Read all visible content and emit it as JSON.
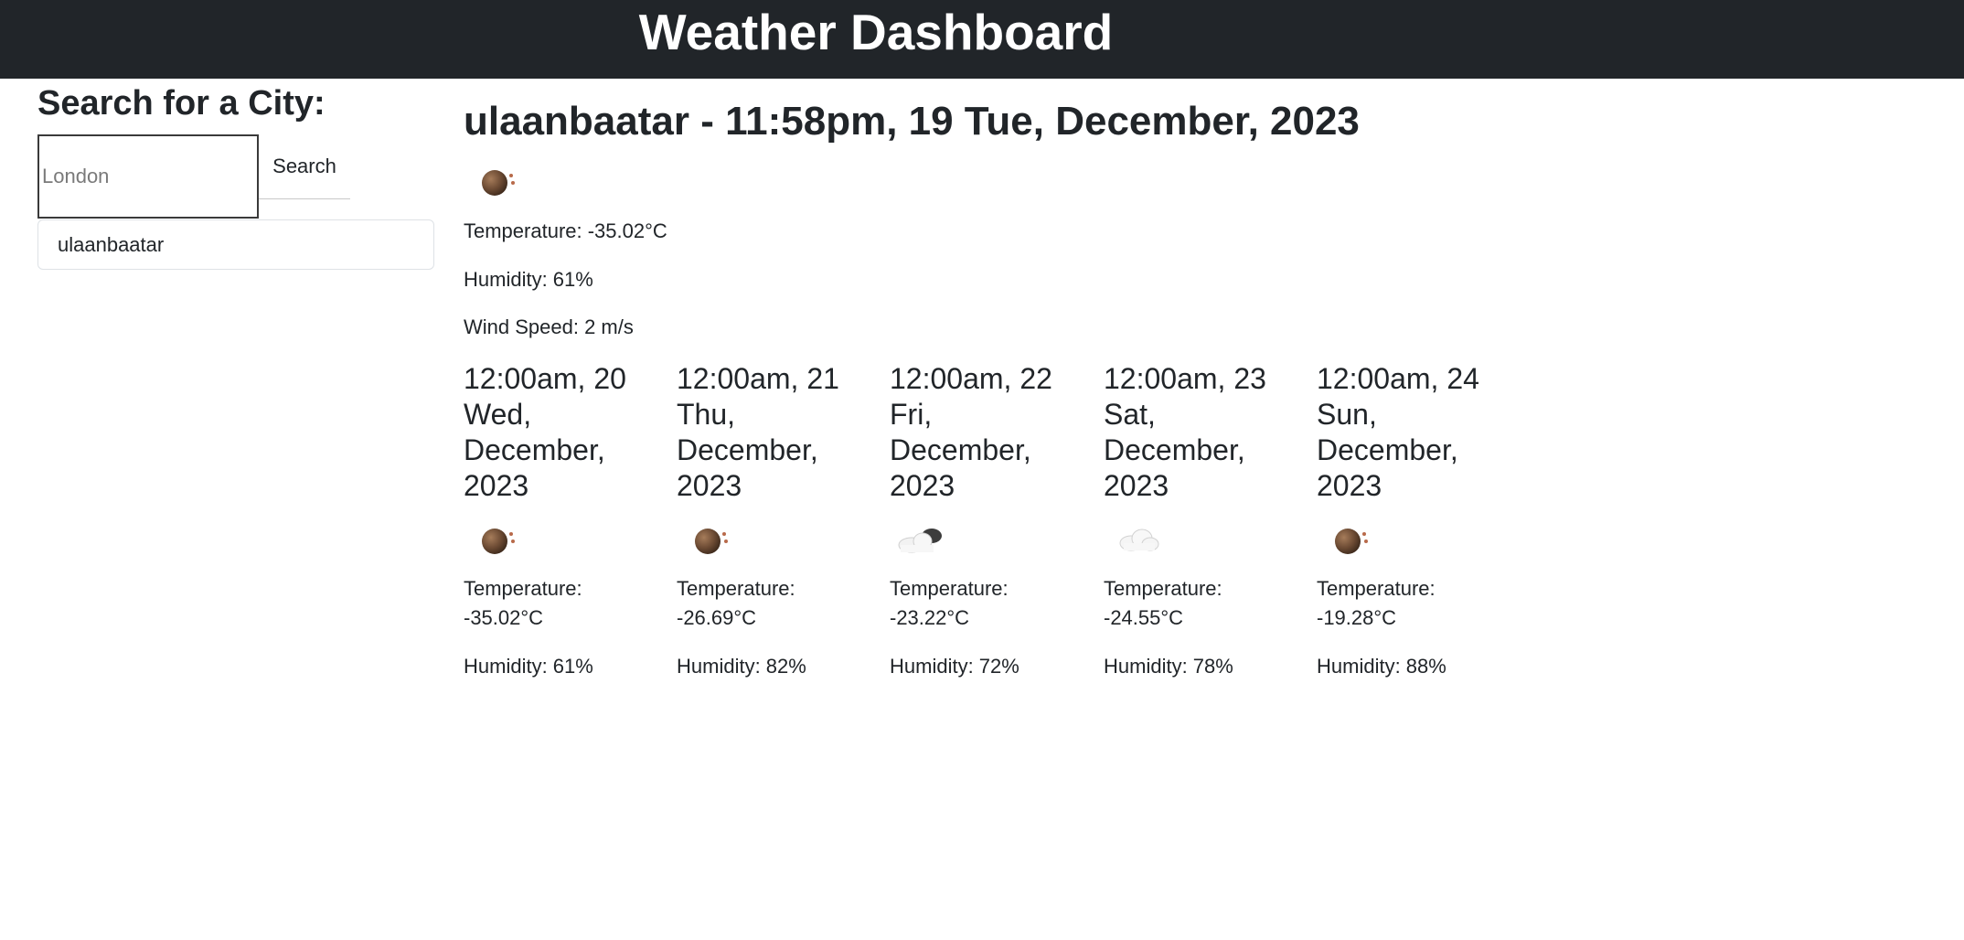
{
  "header": {
    "title": "Weather Dashboard"
  },
  "search": {
    "heading": "Search for a City:",
    "placeholder": "London",
    "value": "",
    "button_label": "Search",
    "history": [
      "ulaanbaatar"
    ]
  },
  "current": {
    "title": "ulaanbaatar - 11:58pm, 19 Tue, December, 2023",
    "icon": "haze-icon",
    "temperature": "Temperature: -35.02°C",
    "humidity": "Humidity: 61%",
    "wind": "Wind Speed: 2 m/s"
  },
  "forecast": [
    {
      "date_line1": "12:00am, 20",
      "date_line2": "Wed,",
      "date_line3": "December,",
      "date_line4": "2023",
      "icon": "haze-icon",
      "temp_label": "Temperature:",
      "temp_value": "-35.02°C",
      "humidity": "Humidity: 61%"
    },
    {
      "date_line1": "12:00am, 21",
      "date_line2": "Thu,",
      "date_line3": "December,",
      "date_line4": "2023",
      "icon": "haze-icon",
      "temp_label": "Temperature:",
      "temp_value": "-26.69°C",
      "humidity": "Humidity: 82%"
    },
    {
      "date_line1": "12:00am, 22",
      "date_line2": "Fri,",
      "date_line3": "December,",
      "date_line4": "2023",
      "icon": "broken-clouds-icon",
      "temp_label": "Temperature:",
      "temp_value": "-23.22°C",
      "humidity": "Humidity: 72%"
    },
    {
      "date_line1": "12:00am, 23",
      "date_line2": "Sat,",
      "date_line3": "December,",
      "date_line4": "2023",
      "icon": "cloud-icon",
      "temp_label": "Temperature:",
      "temp_value": "-24.55°C",
      "humidity": "Humidity: 78%"
    },
    {
      "date_line1": "12:00am, 24",
      "date_line2": "Sun,",
      "date_line3": "December,",
      "date_line4": "2023",
      "icon": "haze-icon",
      "temp_label": "Temperature:",
      "temp_value": "-19.28°C",
      "humidity": "Humidity: 88%"
    }
  ],
  "colors": {
    "header_bg": "#212529",
    "header_text": "#ffffff",
    "text": "#212529",
    "border": "#dee2e6"
  }
}
